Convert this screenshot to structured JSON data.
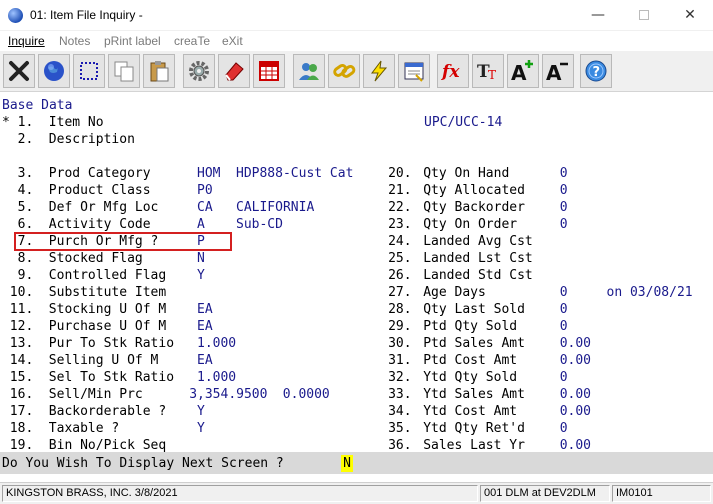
{
  "window": {
    "title": "01: Item File Inquiry -",
    "minimize": "—",
    "close": "✕"
  },
  "menu": [
    {
      "label": "Inquire",
      "state": "active"
    },
    {
      "label": "Notes",
      "state": "disabled"
    },
    {
      "label": "pRint label",
      "state": "disabled"
    },
    {
      "label": "creaTe",
      "state": "disabled"
    },
    {
      "label": "eXit",
      "state": "disabled"
    }
  ],
  "toolbar": [
    {
      "icon": "close-x-icon"
    },
    {
      "icon": "globe-icon"
    },
    {
      "icon": "select-box-icon"
    },
    {
      "icon": "copy-icon"
    },
    {
      "icon": "paste-icon"
    },
    {
      "icon": "gear-icon"
    },
    {
      "icon": "eraser-icon"
    },
    {
      "icon": "table-icon"
    },
    {
      "icon": "users-icon"
    },
    {
      "icon": "chain-link-icon"
    },
    {
      "icon": "lightning-icon"
    },
    {
      "icon": "calendar-window-icon"
    },
    {
      "icon": "function-icon"
    },
    {
      "icon": "font-type-icon"
    },
    {
      "icon": "font-increase-icon"
    },
    {
      "icon": "font-decrease-icon"
    },
    {
      "icon": "help-icon"
    }
  ],
  "screen": {
    "section_title": "Base Data",
    "upc_label": "UPC/UCC-14",
    "prompt": "Do You Wish To Display Next Screen ?",
    "prompt_answer": "N",
    "left_fields": [
      {
        "mark": "*",
        "num": " 1.",
        "label": "Item No",
        "value": "",
        "extra": ""
      },
      {
        "mark": " ",
        "num": " 2.",
        "label": "Description",
        "value": "",
        "extra": ""
      },
      {
        "mark": " ",
        "num": " 3.",
        "label": "Prod Category",
        "value": "HOM",
        "extra": "HDP888-Cust Cat"
      },
      {
        "mark": " ",
        "num": " 4.",
        "label": "Product Class",
        "value": "P0",
        "extra": ""
      },
      {
        "mark": " ",
        "num": " 5.",
        "label": "Def Or Mfg Loc",
        "value": "CA",
        "extra": "CALIFORNIA"
      },
      {
        "mark": " ",
        "num": " 6.",
        "label": "Activity Code",
        "value": "A",
        "extra": "Sub-CD"
      },
      {
        "mark": " ",
        "num": " 7.",
        "label": "Purch Or Mfg ?",
        "value": "P",
        "extra": ""
      },
      {
        "mark": " ",
        "num": " 8.",
        "label": "Stocked Flag",
        "value": "N",
        "extra": ""
      },
      {
        "mark": " ",
        "num": " 9.",
        "label": "Controlled Flag",
        "value": "Y",
        "extra": ""
      },
      {
        "mark": " ",
        "num": "10.",
        "label": "Substitute Item",
        "value": "",
        "extra": ""
      },
      {
        "mark": " ",
        "num": "11.",
        "label": "Stocking U Of M",
        "value": "EA",
        "extra": ""
      },
      {
        "mark": " ",
        "num": "12.",
        "label": "Purchase U Of M",
        "value": "EA",
        "extra": ""
      },
      {
        "mark": " ",
        "num": "13.",
        "label": "Pur To Stk Ratio",
        "value": "1.000",
        "extra": ""
      },
      {
        "mark": " ",
        "num": "14.",
        "label": "Selling U Of M",
        "value": "EA",
        "extra": ""
      },
      {
        "mark": " ",
        "num": "15.",
        "label": "Sel To Stk Ratio",
        "value": "1.000",
        "extra": ""
      },
      {
        "mark": " ",
        "num": "16.",
        "label": "Sell/Min Prc",
        "value": "3,354.9500",
        "extra": "0.0000"
      },
      {
        "mark": " ",
        "num": "17.",
        "label": "Backorderable ?",
        "value": "Y",
        "extra": ""
      },
      {
        "mark": " ",
        "num": "18.",
        "label": "Taxable ?",
        "value": "Y",
        "extra": ""
      },
      {
        "mark": " ",
        "num": "19.",
        "label": "Bin No/Pick Seq",
        "value": "",
        "extra": ""
      }
    ],
    "right_fields": [
      {
        "num": "20.",
        "label": "Qty On Hand",
        "value": "0",
        "extra": ""
      },
      {
        "num": "21.",
        "label": "Qty Allocated",
        "value": "0",
        "extra": ""
      },
      {
        "num": "22.",
        "label": "Qty Backorder",
        "value": "0",
        "extra": ""
      },
      {
        "num": "23.",
        "label": "Qty On Order",
        "value": "0",
        "extra": ""
      },
      {
        "num": "24.",
        "label": "Landed Avg Cst",
        "value": "",
        "extra": ""
      },
      {
        "num": "25.",
        "label": "Landed Lst Cst",
        "value": "",
        "extra": ""
      },
      {
        "num": "26.",
        "label": "Landed Std Cst",
        "value": "",
        "extra": ""
      },
      {
        "num": "27.",
        "label": "Age Days",
        "value": "0",
        "extra": "on 03/08/21"
      },
      {
        "num": "28.",
        "label": "Qty Last Sold",
        "value": "0",
        "extra": ""
      },
      {
        "num": "29.",
        "label": "Ptd Qty Sold",
        "value": "0",
        "extra": ""
      },
      {
        "num": "30.",
        "label": "Ptd Sales Amt",
        "value": "0.00",
        "extra": ""
      },
      {
        "num": "31.",
        "label": "Ptd Cost Amt",
        "value": "0.00",
        "extra": ""
      },
      {
        "num": "32.",
        "label": "Ytd Qty Sold",
        "value": "0",
        "extra": ""
      },
      {
        "num": "33.",
        "label": "Ytd Sales Amt",
        "value": "0.00",
        "extra": ""
      },
      {
        "num": "34.",
        "label": "Ytd Cost Amt",
        "value": "0.00",
        "extra": ""
      },
      {
        "num": "35.",
        "label": "Ytd Qty Ret'd",
        "value": "0",
        "extra": ""
      },
      {
        "num": "36.",
        "label": "Sales Last Yr",
        "value": "0.00",
        "extra": ""
      }
    ]
  },
  "status": {
    "company": "KINGSTON BRASS, INC. 3/8/2021",
    "session": "001 DLM at DEV2DLM",
    "program": "IM0101"
  },
  "colors": {
    "label": "#000000",
    "value": "#1a1a8c",
    "highlight": "#d42020",
    "answer_bg": "#ffff00"
  }
}
